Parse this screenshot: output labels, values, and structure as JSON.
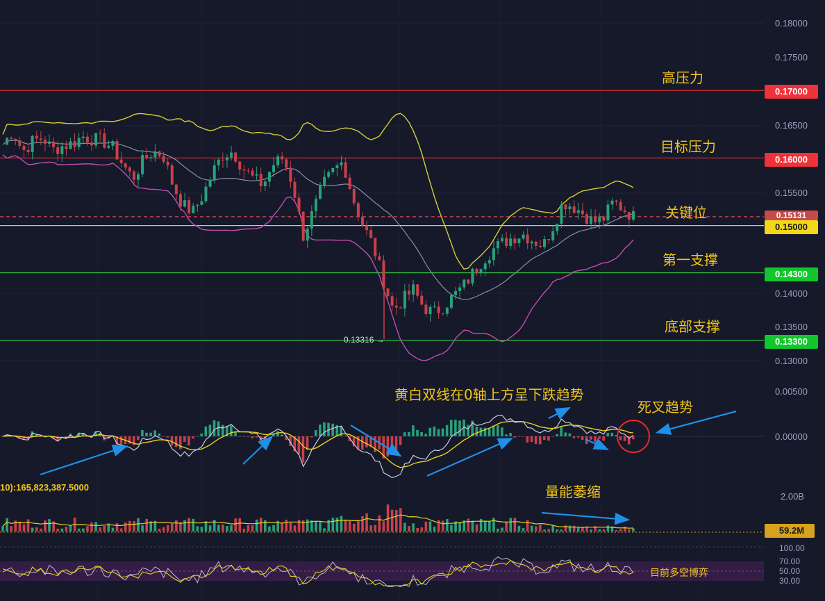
{
  "colors": {
    "background": "#15192a",
    "resistance": "#d82a2a",
    "support": "#2fc23a",
    "key_level": "#e8d21c",
    "upper_band": "#d8cc36",
    "lower_band": "#c04fb0",
    "middle_band": "#8a8fa8",
    "candle_up": "#2aa07a",
    "candle_down": "#c8404a",
    "annotation_text": "#f0c419",
    "arrow": "#1f8fe8"
  },
  "annotations": {
    "high_pressure": "高压力",
    "target_pressure": "目标压力",
    "key_level": "关键位",
    "first_support": "第一支撑",
    "bottom_support": "底部支撑",
    "macd_note": "黄白双线在0轴上方呈下跌趋势",
    "death_cross": "死叉趋势",
    "volume_note": "量能萎缩",
    "rsi_note": "目前多空博弈"
  },
  "indicators": {
    "volume_ma_label": "10):165,823,387.5000",
    "low_marker": "0.13316"
  },
  "chart_data": {
    "type": "candlestick",
    "price_axis": {
      "range": [
        0.128,
        0.185
      ],
      "ticks": [
        "0.18000",
        "0.17500",
        "0.16500",
        "0.15500",
        "0.14000",
        "0.13500",
        "0.13000"
      ]
    },
    "levels": [
      {
        "label": "0.17000",
        "value": 0.17,
        "kind": "resistance",
        "note": "高压力"
      },
      {
        "label": "0.16000",
        "value": 0.16,
        "kind": "resistance",
        "note": "目标压力"
      },
      {
        "label": "0.15131",
        "value": 0.15131,
        "kind": "current",
        "note": ""
      },
      {
        "label": "0.15000",
        "value": 0.15,
        "kind": "key",
        "note": "关键位"
      },
      {
        "label": "0.14300",
        "value": 0.143,
        "kind": "support",
        "note": "第一支撑"
      },
      {
        "label": "0.13300",
        "value": 0.133,
        "kind": "support",
        "note": "底部支撑"
      }
    ],
    "price_path": [
      0.162,
      0.164,
      0.161,
      0.1625,
      0.163,
      0.1612,
      0.1618,
      0.1622,
      0.1632,
      0.1628,
      0.1625,
      0.1615,
      0.159,
      0.157,
      0.1595,
      0.161,
      0.1605,
      0.156,
      0.153,
      0.152,
      0.1545,
      0.158,
      0.1605,
      0.161,
      0.1585,
      0.157,
      0.156,
      0.159,
      0.16,
      0.156,
      0.1485,
      0.152,
      0.156,
      0.158,
      0.1595,
      0.154,
      0.15,
      0.147,
      0.142,
      0.1375,
      0.139,
      0.1405,
      0.138,
      0.137,
      0.138,
      0.1395,
      0.141,
      0.143,
      0.145,
      0.1465,
      0.1475,
      0.1483,
      0.1487,
      0.1478,
      0.147,
      0.15,
      0.1535,
      0.1528,
      0.1518,
      0.1505,
      0.151,
      0.1535,
      0.1525,
      0.1513
    ],
    "low_value": 0.13316,
    "macd_axis": {
      "ticks": [
        "0.00500",
        "0.00000"
      ]
    },
    "volume_axis": {
      "ticks": [
        "2.00B"
      ],
      "current": "59.2M"
    },
    "rsi_axis": {
      "ticks": [
        "100.00",
        "70.00",
        "50.00",
        "30.00"
      ]
    }
  }
}
